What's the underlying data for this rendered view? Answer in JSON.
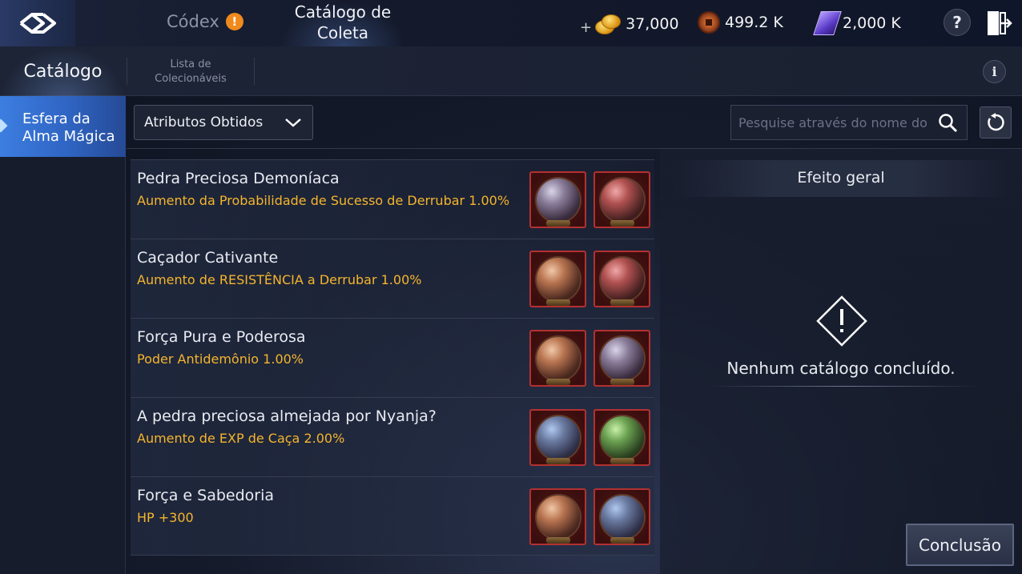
{
  "topbar": {
    "codex_label": "Códex",
    "codex_alert": "!",
    "catalog_line1": "Catálogo de",
    "catalog_line2": "Coleta",
    "plus": "+",
    "gold": "37,000",
    "coins": "499.2 K",
    "crystals": "2,000 K",
    "help": "?"
  },
  "subbar": {
    "main_tab": "Catálogo",
    "list_tab_line1": "Lista de",
    "list_tab_line2": "Colecionáveis",
    "info": "i"
  },
  "sidebar": {
    "items": [
      {
        "line1": "Esfera da",
        "line2": "Alma Mágica"
      }
    ]
  },
  "filters": {
    "dropdown_value": "Atributos Obtidos",
    "search_placeholder": "Pesquise através do nome do"
  },
  "list": [
    {
      "title": "Pedra Preciosa Demoníaca",
      "effect": "Aumento da Probabilidade de Sucesso de Derrubar 1.00%"
    },
    {
      "title": "Caçador Cativante",
      "effect": "Aumento de RESISTÊNCIA a Derrubar 1.00%"
    },
    {
      "title": "Força Pura e Poderosa",
      "effect": "Poder Antidemônio 1.00%"
    },
    {
      "title": "A pedra preciosa almejada por Nyanja?",
      "effect": "Aumento de EXP de Caça 2.00%"
    },
    {
      "title": "Força e Sabedoria",
      "effect": "HP +300"
    }
  ],
  "panel": {
    "title": "Efeito geral",
    "empty_message": "Nenhum catálogo concluído."
  },
  "actions": {
    "done_label": "Conclusão"
  },
  "colors": {
    "accent_blue": "#2f64c2",
    "effect_gold": "#f5b52d",
    "slot_border": "#b33131"
  }
}
